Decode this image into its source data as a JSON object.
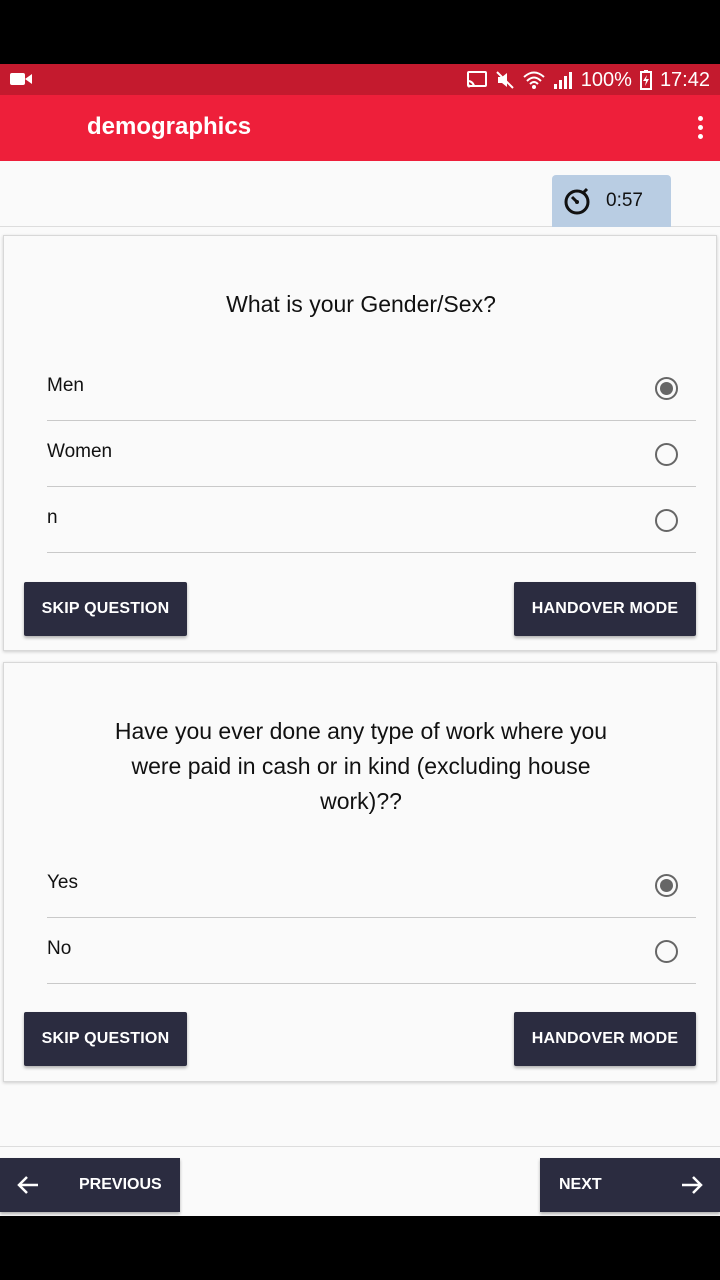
{
  "status_bar": {
    "battery": "100%",
    "time": "17:42"
  },
  "app_bar": {
    "title": "demographics"
  },
  "timer": {
    "value": "0:57"
  },
  "questions": [
    {
      "text": "What is your Gender/Sex?",
      "options": [
        {
          "label": "Men",
          "checked": true
        },
        {
          "label": "Women",
          "checked": false
        },
        {
          "label": "n",
          "checked": false
        }
      ],
      "skip_label": "SKIP QUESTION",
      "handover_label": "HANDOVER MODE"
    },
    {
      "text": "Have you ever done any type of work where you were paid in cash or in kind (excluding house work)??",
      "options": [
        {
          "label": "Yes",
          "checked": true
        },
        {
          "label": "No",
          "checked": false
        }
      ],
      "skip_label": "SKIP QUESTION",
      "handover_label": "HANDOVER MODE"
    }
  ],
  "navigation": {
    "previous_label": "PREVIOUS",
    "next_label": "NEXT"
  },
  "colors": {
    "status_bar": "#c41a2e",
    "app_bar": "#ee1f3a",
    "button": "#2b2c40",
    "timer_bg": "#b9cde3"
  }
}
